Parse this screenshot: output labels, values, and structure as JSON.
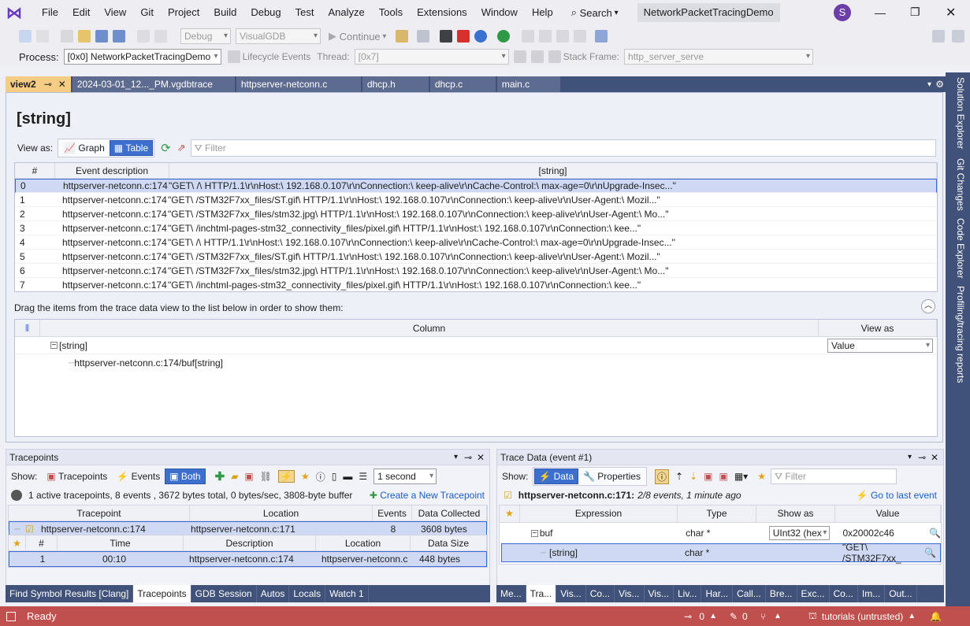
{
  "menu": {
    "items": [
      "File",
      "Edit",
      "View",
      "Git",
      "Project",
      "Build",
      "Debug",
      "Test",
      "Analyze",
      "Tools",
      "Extensions",
      "Window",
      "Help"
    ],
    "search": "Search",
    "solution": "NetworkPacketTracingDemo",
    "avatar": "S"
  },
  "toolbar": {
    "config": "Debug",
    "platform": "VisualGDB",
    "continue": "Continue"
  },
  "debugbar": {
    "process_label": "Process:",
    "process_value": "[0x0] NetworkPacketTracingDemo",
    "lifecycle": "Lifecycle Events",
    "thread_label": "Thread:",
    "thread_value": "[0x7]",
    "frame_label": "Stack Frame:",
    "frame_value": "http_server_serve"
  },
  "tabs": [
    "view2",
    "2024-03-01_12..._PM.vgdbtrace",
    "httpserver-netconn.c",
    "dhcp.h",
    "dhcp.c",
    "main.c"
  ],
  "side_tabs": [
    "Solution Explorer",
    "Git Changes",
    "Code Explorer",
    "Profiling/tracing reports"
  ],
  "doc": {
    "title": "[string]",
    "viewas": "View as:",
    "graph": "Graph",
    "table": "Table",
    "filter_placeholder": "Filter",
    "columns": [
      "#",
      "Event description",
      "[string]"
    ],
    "rows": [
      [
        "0",
        "httpserver-netconn.c:174",
        "\"GET\\ /\\ HTTP/1.1\\r\\nHost:\\ 192.168.0.107\\r\\nConnection:\\ keep-alive\\r\\nCache-Control:\\ max-age=0\\r\\nUpgrade-Insec...\""
      ],
      [
        "1",
        "httpserver-netconn.c:174",
        "\"GET\\ /STM32F7xx_files/ST.gif\\ HTTP/1.1\\r\\nHost:\\ 192.168.0.107\\r\\nConnection:\\ keep-alive\\r\\nUser-Agent:\\ Mozil...\""
      ],
      [
        "2",
        "httpserver-netconn.c:174",
        "\"GET\\ /STM32F7xx_files/stm32.jpg\\ HTTP/1.1\\r\\nHost:\\ 192.168.0.107\\r\\nConnection:\\ keep-alive\\r\\nUser-Agent:\\ Mo...\""
      ],
      [
        "3",
        "httpserver-netconn.c:174",
        "\"GET\\ /inchtml-pages-stm32_connectivity_files/pixel.gif\\ HTTP/1.1\\r\\nHost:\\ 192.168.0.107\\r\\nConnection:\\ kee...\""
      ],
      [
        "4",
        "httpserver-netconn.c:174",
        "\"GET\\ /\\ HTTP/1.1\\r\\nHost:\\ 192.168.0.107\\r\\nConnection:\\ keep-alive\\r\\nCache-Control:\\ max-age=0\\r\\nUpgrade-Insec...\""
      ],
      [
        "5",
        "httpserver-netconn.c:174",
        "\"GET\\ /STM32F7xx_files/ST.gif\\ HTTP/1.1\\r\\nHost:\\ 192.168.0.107\\r\\nConnection:\\ keep-alive\\r\\nUser-Agent:\\ Mozil...\""
      ],
      [
        "6",
        "httpserver-netconn.c:174",
        "\"GET\\ /STM32F7xx_files/stm32.jpg\\ HTTP/1.1\\r\\nHost:\\ 192.168.0.107\\r\\nConnection:\\ keep-alive\\r\\nUser-Agent:\\ Mo...\""
      ],
      [
        "7",
        "httpserver-netconn.c:174",
        "\"GET\\ /inchtml-pages-stm32_connectivity_files/pixel.gif\\ HTTP/1.1\\r\\nHost:\\ 192.168.0.107\\r\\nConnection:\\ kee...\""
      ]
    ],
    "drag_hint": "Drag the items from the trace data view to the list below in order to show them:",
    "col_header": "Column",
    "viewas_header": "View as",
    "tree_root": "[string]",
    "tree_child": "httpserver-netconn.c:174/buf[string]",
    "viewas_value": "Value"
  },
  "tracepoints": {
    "title": "Tracepoints",
    "show": "Show:",
    "tp": "Tracepoints",
    "events": "Events",
    "both": "Both",
    "interval": "1 second",
    "summary": "1 active tracepoints, 8 events , 3672 bytes total, 0 bytes/sec, 3808-byte buffer",
    "create": "Create a New Tracepoint",
    "cols": [
      "Tracepoint",
      "Location",
      "Events",
      "Data Collected"
    ],
    "row": [
      "httpserver-netconn.c:174",
      "httpserver-netconn.c:171",
      "8",
      "3608 bytes"
    ],
    "ev_cols": [
      "#",
      "Time",
      "Description",
      "Location",
      "Data Size"
    ],
    "ev_row": [
      "1",
      "00:10",
      "httpserver-netconn.c:174",
      "httpserver-netconn.c",
      "448 bytes"
    ],
    "tabs": [
      "Find Symbol Results [Clang]",
      "Tracepoints",
      "GDB Session",
      "Autos",
      "Locals",
      "Watch 1"
    ]
  },
  "tracedata": {
    "title": "Trace Data (event #1)",
    "show": "Show:",
    "data": "Data",
    "props": "Properties",
    "filter": "Filter",
    "event_loc": "httpserver-netconn.c:171:",
    "event_info": "2/8 events, 1 minute ago",
    "goto": "Go to last event",
    "cols": [
      "Expression",
      "Type",
      "Show as",
      "Value"
    ],
    "r1": [
      "buf",
      "char *",
      "UInt32 (hex",
      "0x20002c46"
    ],
    "r2": [
      "[string]",
      "char *",
      "",
      "\"GET\\ /STM32F7xx_"
    ],
    "tabs": [
      "Me...",
      "Tra...",
      "Vis...",
      "Co...",
      "Vis...",
      "Vis...",
      "Liv...",
      "Har...",
      "Call...",
      "Bre...",
      "Exc...",
      "Co...",
      "Im...",
      "Out..."
    ]
  },
  "status": {
    "ready": "Ready",
    "errors": "0",
    "edits": "0",
    "repo": "tutorials (untrusted)"
  }
}
